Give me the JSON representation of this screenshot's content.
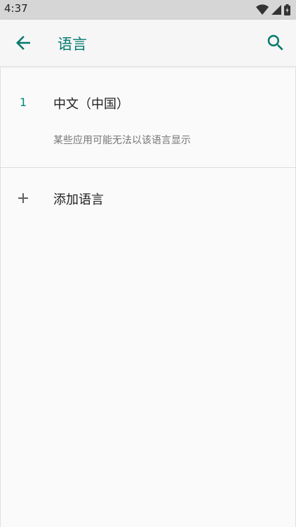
{
  "status_bar": {
    "time": "4:37",
    "icons": [
      "wifi-icon",
      "signal-icon",
      "battery-icon"
    ]
  },
  "app_bar": {
    "title": "语言",
    "back_icon": "arrow-left-icon",
    "search_icon": "search-icon"
  },
  "languages": [
    {
      "index": "1",
      "name": "中文（中国）",
      "note": "某些应用可能无法以该语言显示"
    }
  ],
  "add_language": {
    "label": "添加语言",
    "icon": "plus-icon"
  },
  "colors": {
    "accent": "#00796b",
    "background": "#fafafa",
    "status_bar": "#d6d6d6",
    "primary_text": "#212121",
    "secondary_text": "#757575"
  }
}
